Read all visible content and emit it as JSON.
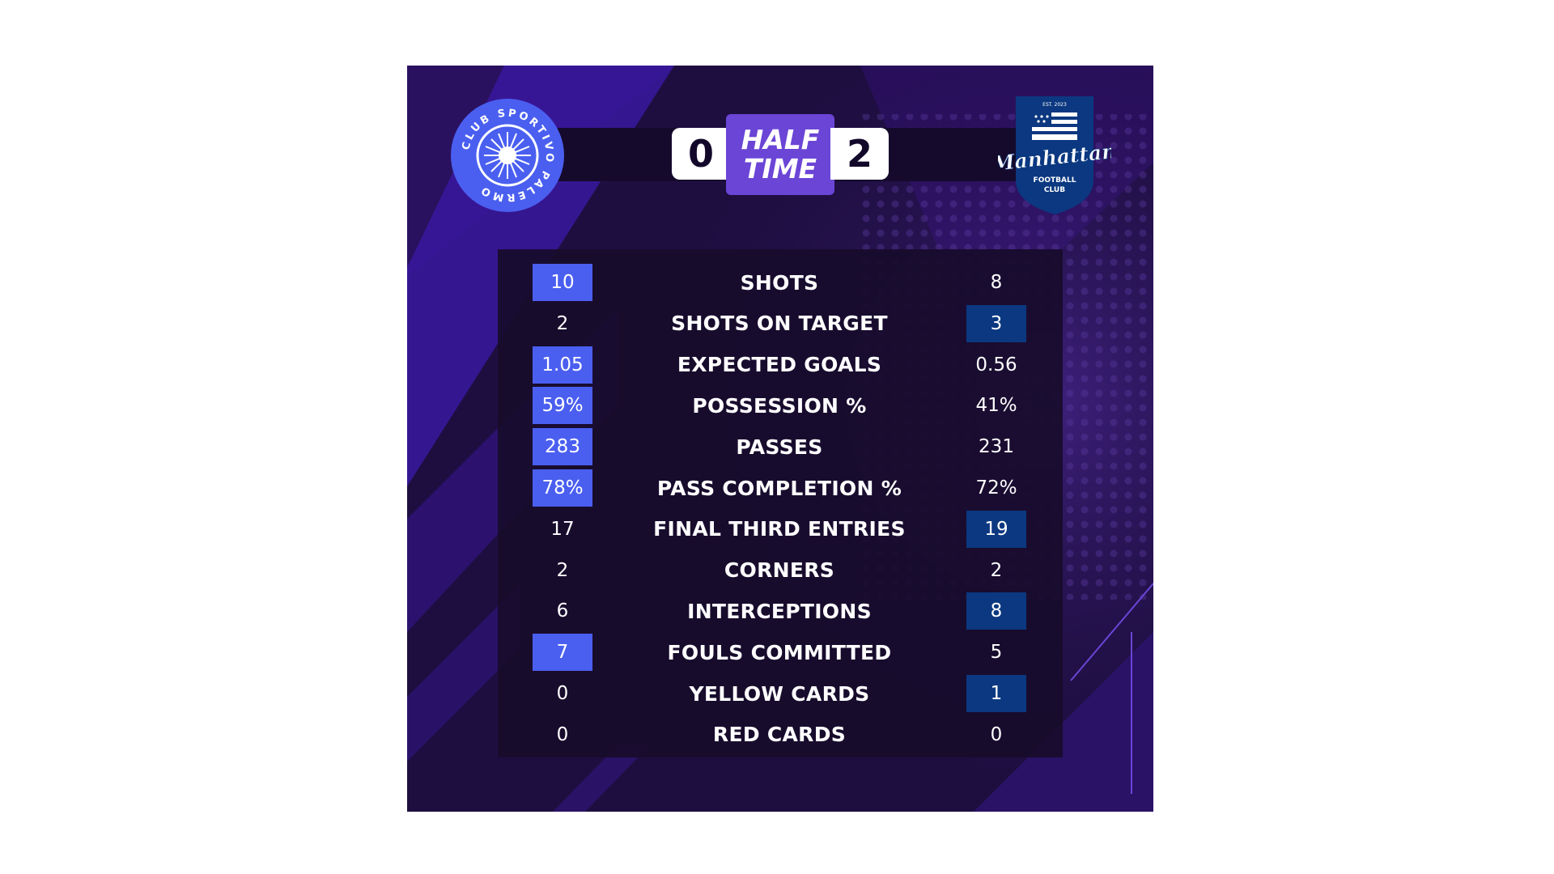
{
  "home_team": {
    "crest_text": "CLUB SPORTIVO PALERMO",
    "score": "0",
    "highlight_color": "#4a5ff0"
  },
  "away_team": {
    "crest_est": "EST. 2023",
    "crest_name": "Manhattan",
    "crest_sub_1": "FOOTBALL",
    "crest_sub_2": "CLUB",
    "score": "2",
    "highlight_color": "#0b3880"
  },
  "status": {
    "line1": "HALF",
    "line2": "TIME",
    "color": "#6b45d6"
  },
  "stats": [
    {
      "label": "SHOTS",
      "home": "10",
      "away": "8",
      "leader": "home"
    },
    {
      "label": "SHOTS ON TARGET",
      "home": "2",
      "away": "3",
      "leader": "away"
    },
    {
      "label": "EXPECTED GOALS",
      "home": "1.05",
      "away": "0.56",
      "leader": "home"
    },
    {
      "label": "POSSESSION %",
      "home": "59%",
      "away": "41%",
      "leader": "home"
    },
    {
      "label": "PASSES",
      "home": "283",
      "away": "231",
      "leader": "home"
    },
    {
      "label": "PASS COMPLETION %",
      "home": "78%",
      "away": "72%",
      "leader": "home"
    },
    {
      "label": "FINAL THIRD ENTRIES",
      "home": "17",
      "away": "19",
      "leader": "away"
    },
    {
      "label": "CORNERS",
      "home": "2",
      "away": "2",
      "leader": "none"
    },
    {
      "label": "INTERCEPTIONS",
      "home": "6",
      "away": "8",
      "leader": "away"
    },
    {
      "label": "FOULS COMMITTED",
      "home": "7",
      "away": "5",
      "leader": "home"
    },
    {
      "label": "YELLOW CARDS",
      "home": "0",
      "away": "1",
      "leader": "away"
    },
    {
      "label": "RED CARDS",
      "home": "0",
      "away": "0",
      "leader": "none"
    }
  ]
}
